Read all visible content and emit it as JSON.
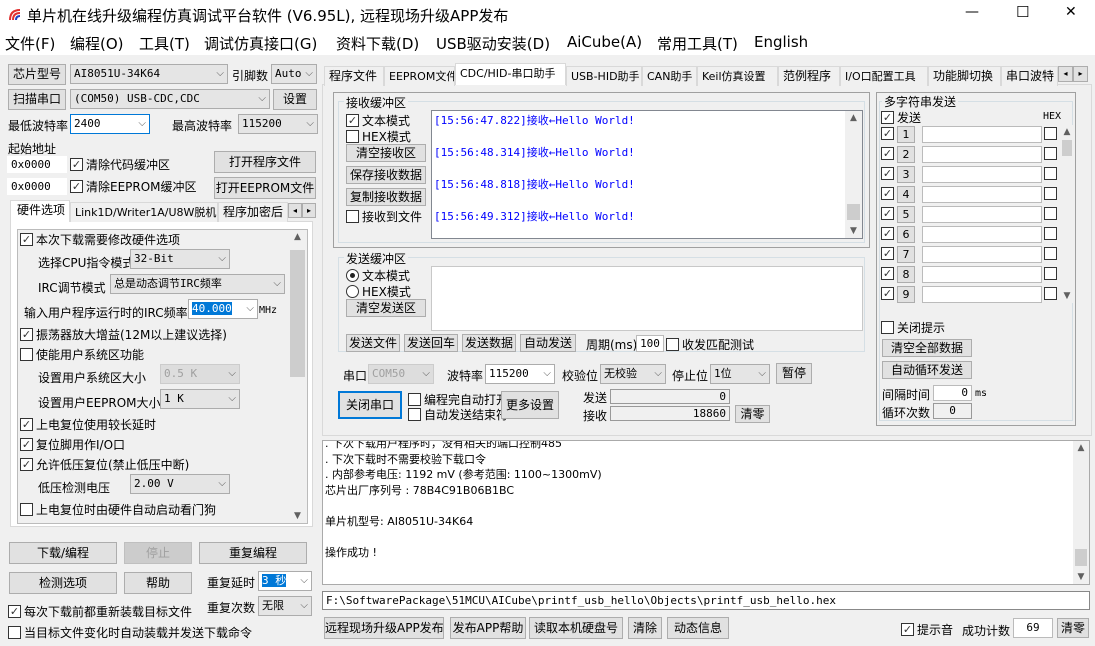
{
  "window": {
    "title": "单片机在线升级编程仿真调试平台软件 (V6.95L), 远程现场升级APP发布",
    "minimize": "—",
    "maximize": "☐",
    "close": "✕"
  },
  "menu": [
    "文件(F)",
    "编程(O)",
    "工具(T)",
    "调试仿真接口(G)",
    "资料下载(D)",
    "USB驱动安装(D)",
    "AiCube(A)",
    "常用工具(T)",
    "English"
  ],
  "left": {
    "chip_btn": "芯片型号",
    "chip_value": "AI8051U-34K64",
    "pins_label": "引脚数",
    "pins_value": "Auto",
    "scan_btn": "扫描串口",
    "port_value": "(COM50) USB-CDC,CDC",
    "settings_btn": "设置",
    "min_baud_label": "最低波特率",
    "min_baud": "2400",
    "max_baud_label": "最高波特率",
    "max_baud": "115200",
    "start_addr_label": "起始地址",
    "addr1": "0x0000",
    "clear_code": "清除代码缓冲区",
    "open_prog": "打开程序文件",
    "addr2": "0x0000",
    "clear_eeprom": "清除EEPROM缓冲区",
    "open_eeprom": "打开EEPROM文件",
    "tabs": [
      "硬件选项",
      "Link1D/Writer1A/U8W脱机",
      "程序加密后"
    ],
    "hw": {
      "modify_hw": "本次下载需要修改硬件选项",
      "cpu_mode_label": "选择CPU指令模式",
      "cpu_mode": "32-Bit",
      "irc_mode_label": "IRC调节模式",
      "irc_mode": "总是动态调节IRC频率",
      "irc_freq_label": "输入用户程序运行时的IRC频率",
      "irc_freq": "40.000",
      "irc_unit": "MHz",
      "osc_gain": "振荡器放大增益(12M以上建议选择)",
      "user_sys": "使能用户系统区功能",
      "sys_size_label": "设置用户系统区大小",
      "sys_size": "0.5 K",
      "eeprom_size_label": "设置用户EEPROM大小",
      "eeprom_size": "1   K",
      "long_delay": "上电复位使用较长延时",
      "reset_io": "复位脚用作I/O口",
      "lvr": "允许低压复位(禁止低压中断)",
      "lvd_label": "低压检测电压",
      "lvd": "2.00 V",
      "wdt": "上电复位时由硬件自动启动看门狗"
    },
    "download_btn": "下载/编程",
    "stop_btn": "停止",
    "repeat_btn": "重复编程",
    "detect_btn": "检测选项",
    "help_btn": "帮助",
    "repeat_delay_label": "重复延时",
    "repeat_delay": "3 秒",
    "repeat_count_label": "重复次数",
    "repeat_count": "无限",
    "reload": "每次下载前都重新装载目标文件",
    "auto_load": "当目标文件变化时自动装载并发送下载命令"
  },
  "tabs": [
    "程序文件",
    "EEPROM文件",
    "CDC/HID-串口助手",
    "USB-HID助手",
    "CAN助手",
    "Keil仿真设置",
    "范例程序",
    "I/O口配置工具",
    "功能脚切换",
    "串口波特"
  ],
  "serial": {
    "rx_group": "接收缓冲区",
    "rx_text_mode": "文本模式",
    "rx_hex_mode": "HEX模式",
    "clear_rx": "清空接收区",
    "save_rx": "保存接收数据",
    "copy_rx": "复制接收数据",
    "rx_to_file": "接收到文件",
    "rx_lines": [
      "[15:56:47.822]接收←Hello World!",
      "[15:56:48.314]接收←Hello World!",
      "[15:56:48.818]接收←Hello World!",
      "[15:56:49.312]接收←Hello World!"
    ],
    "tx_group": "发送缓冲区",
    "tx_text_mode": "文本模式",
    "tx_hex_mode": "HEX模式",
    "clear_tx": "清空发送区",
    "send_file": "发送文件",
    "send_cr": "发送回车",
    "send_data": "发送数据",
    "auto_send": "自动发送",
    "period_label": "周期(ms)",
    "period": "100",
    "match_test": "收发匹配测试",
    "port_label": "串口",
    "port": "COM50",
    "baud_label": "波特率",
    "baud": "115200",
    "parity_label": "校验位",
    "parity": "无校验",
    "stop_label": "停止位",
    "stop": "1位",
    "pause": "暂停",
    "close_port": "关闭串口",
    "auto_open": "编程完自动打开",
    "auto_end": "自动发送结束符",
    "more": "更多设置",
    "sent_label": "发送",
    "sent": "0",
    "recv_label": "接收",
    "recv": "18860",
    "clear_counts": "清零"
  },
  "multi": {
    "group": "多字符串发送",
    "send_label": "发送",
    "hex_label": "HEX",
    "rows": [
      "1",
      "2",
      "3",
      "4",
      "5",
      "6",
      "7",
      "8",
      "9"
    ],
    "close_tip": "关闭提示",
    "clear_all": "清空全部数据",
    "auto_loop": "自动循环发送",
    "interval_label": "间隔时间",
    "interval": "0",
    "interval_unit": "ms",
    "loop_label": "循环次数",
    "loop": "0"
  },
  "log": [
    ". 下次下载用户程序时，没有相关的端口控制485",
    ". 下次下载时不需要校验下载口令",
    ". 内部参考电压: 1192 mV (参考范围: 1100~1300mV)",
    "芯片出厂序列号 : 78B4C91B06B1BC",
    "",
    "  单片机型号: AI8051U-34K64",
    "",
    "操作成功 !"
  ],
  "path": "F:\\SoftwarePackage\\51MCU\\AICube\\printf_usb_hello\\Objects\\printf_usb_hello.hex",
  "bottom": {
    "publish": "远程现场升级APP发布",
    "publish_help": "发布APP帮助",
    "read_disk": "读取本机硬盘号",
    "clear": "清除",
    "dyn_info": "动态信息",
    "beep": "提示音",
    "success_label": "成功计数",
    "success": "69",
    "reset": "清零"
  }
}
